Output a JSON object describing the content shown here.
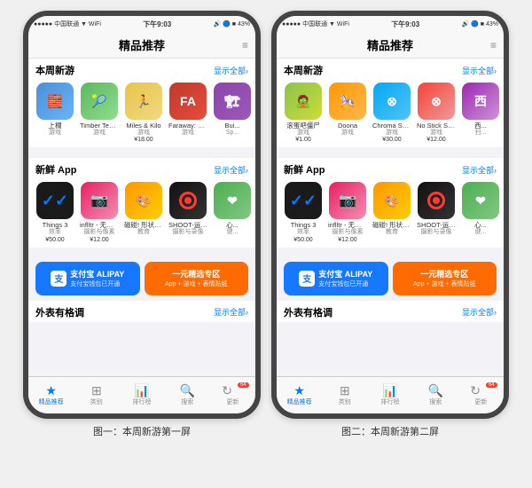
{
  "page": {
    "bg_color": "#f0f0f0"
  },
  "captions": {
    "left": "图一：本周新游第一屏",
    "right": "图二：本周新游第二屏"
  },
  "phones": [
    {
      "id": "left",
      "status": {
        "carrier": "中国联通",
        "wifi": "WiFi",
        "time": "下午9:03",
        "battery": "43%"
      },
      "nav_title": "精品推荐",
      "sections": [
        {
          "id": "new_games",
          "title": "本周新游",
          "more": "显示全部›",
          "apps": [
            {
              "name": "上橺",
              "sub": "游戏",
              "price": "",
              "icon_class": "icon-shangchuan",
              "icon_text": "🧱"
            },
            {
              "name": "Timber Tennis",
              "sub": "游戏",
              "price": "",
              "icon_class": "icon-timber",
              "icon_text": "🎾"
            },
            {
              "name": "Miles & Kilo",
              "sub": "游戏",
              "price": "¥18.00",
              "icon_class": "icon-miles",
              "icon_text": "🏃"
            },
            {
              "name": "Faraway: Puzzle Esca...",
              "sub": "游戏",
              "price": "",
              "icon_class": "icon-faraway",
              "icon_text": "FA"
            },
            {
              "name": "Bui...",
              "sub": "Sp...",
              "price": "",
              "icon_class": "icon-build",
              "icon_text": "🏗"
            }
          ]
        },
        {
          "id": "fresh_apps",
          "title": "新鲜 App",
          "more": "显示全部›",
          "apps": [
            {
              "name": "Things 3",
              "sub": "效率",
              "price": "¥50.00",
              "icon_class": "things3-icon",
              "icon_text": "✓",
              "is_things": true
            },
            {
              "name": "inflltr - 无限滤镜和颜色",
              "sub": "摄影与像素",
              "price": "¥12.00",
              "icon_class": "icon-inflltr",
              "icon_text": "📷",
              "is_camera": true
            },
            {
              "name": "磁碰! 形状和颜色",
              "sub": "教育",
              "price": "",
              "icon_class": "icon-ciji",
              "icon_text": "🎨"
            },
            {
              "name": "SHOOT-运动电影制作神器",
              "sub": "摄影与录像",
              "price": "",
              "icon_class": "icon-shoot",
              "is_shoot": true
            },
            {
              "name": "心...",
              "sub": "健...",
              "price": "",
              "icon_class": "icon-health",
              "icon_text": "❤"
            }
          ]
        }
      ],
      "banners": {
        "alipay_title": "支付宝",
        "alipay_subtitle": "支付宝钱包已开通",
        "alipay_label": "ALIPAY",
        "one_yuan_title": "一元精选专区",
        "one_yuan_sub": "App + 游戏 + 表情贴纸"
      },
      "bottom_section_title": "外表有格调",
      "bottom_more": "显示全部›",
      "tabs": [
        {
          "label": "精品推荐",
          "icon": "★",
          "active": true
        },
        {
          "label": "类别",
          "icon": "⊞",
          "active": false
        },
        {
          "label": "排行榜",
          "icon": "↑↓",
          "active": false
        },
        {
          "label": "搜索",
          "icon": "🔍",
          "active": false
        },
        {
          "label": "更新",
          "icon": "↻",
          "active": false,
          "badge": "64"
        }
      ]
    },
    {
      "id": "right",
      "status": {
        "carrier": "中国联通",
        "wifi": "WiFi",
        "time": "下午9:03",
        "battery": "43%"
      },
      "nav_title": "精品推荐",
      "sections": [
        {
          "id": "new_games",
          "title": "本周新游",
          "more": "显示全部›",
          "apps": [
            {
              "name": "滚蛋吧僵尸",
              "sub": "游戏",
              "price": "¥1.00",
              "icon_class": "icon-gungun",
              "icon_text": "🧟"
            },
            {
              "name": "Doona",
              "sub": "游戏",
              "price": "",
              "icon_class": "icon-doona",
              "icon_text": "🎠"
            },
            {
              "name": "Chroma Squad",
              "sub": "游戏",
              "price": "¥30.00",
              "icon_class": "icon-chroma",
              "icon_text": "⊗"
            },
            {
              "name": "No Stick Shooter",
              "sub": "游戏",
              "price": "¥12.00",
              "icon_class": "icon-nostick",
              "icon_text": "⊗"
            },
            {
              "name": "西...",
              "sub": "扫...",
              "price": "",
              "icon_class": "icon-xi",
              "icon_text": "西"
            }
          ]
        },
        {
          "id": "fresh_apps",
          "title": "新鲜 App",
          "more": "显示全部›",
          "apps": [
            {
              "name": "Things 3",
              "sub": "效率",
              "price": "¥50.00",
              "icon_class": "things3-icon",
              "icon_text": "✓",
              "is_things": true
            },
            {
              "name": "inflltr - 无限滤镜和颜色",
              "sub": "摄影与像素",
              "price": "¥12.00",
              "icon_class": "icon-inflltr",
              "icon_text": "📷",
              "is_camera": true
            },
            {
              "name": "磁碰! 形状和颜色",
              "sub": "教育",
              "price": "",
              "icon_class": "icon-ciji",
              "icon_text": "🎨"
            },
            {
              "name": "SHOOT-运动电影制作神器",
              "sub": "摄影与录像",
              "price": "",
              "icon_class": "icon-shoot",
              "is_shoot": true
            },
            {
              "name": "心...",
              "sub": "健...",
              "price": "",
              "icon_class": "icon-health",
              "icon_text": "❤"
            }
          ]
        }
      ],
      "banners": {
        "alipay_title": "支付宝",
        "alipay_subtitle": "支付宝钱包已开通",
        "alipay_label": "ALIPAY",
        "one_yuan_title": "一元精选专区",
        "one_yuan_sub": "App + 游戏 + 表情贴纸"
      },
      "bottom_section_title": "外表有格调",
      "bottom_more": "显示全部›",
      "tabs": [
        {
          "label": "精品推荐",
          "icon": "★",
          "active": true
        },
        {
          "label": "类别",
          "icon": "⊞",
          "active": false
        },
        {
          "label": "排行榜",
          "icon": "↑↓",
          "active": false
        },
        {
          "label": "搜索",
          "icon": "🔍",
          "active": false
        },
        {
          "label": "更新",
          "icon": "↻",
          "active": false,
          "badge": "64"
        }
      ]
    }
  ]
}
